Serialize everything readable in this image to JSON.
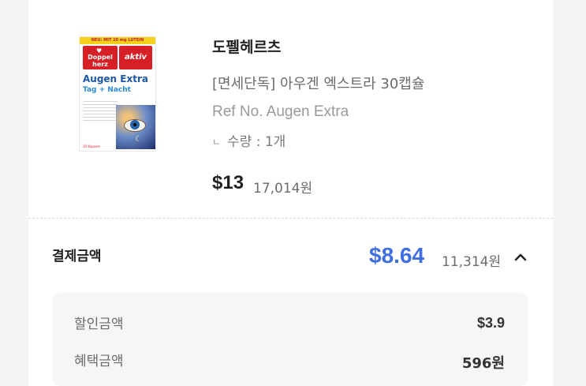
{
  "product": {
    "brand": "도펠헤르츠",
    "name": "[면세단독] 아우겐 엑스트라 30캡슐",
    "ref": "Ref No. Augen Extra",
    "quantity_marker": "ㄴ",
    "quantity": "수량 : 1개",
    "price_usd": "$13",
    "price_krw": "17,014원",
    "image": {
      "top_band": "NEU: MIT 20 mg LUTEIN",
      "logo": "Doppel herz",
      "badge": "aktiv",
      "title": "Augen Extra",
      "subtitle": "Tag + Nacht",
      "footer": "30 Kapseln"
    }
  },
  "payment": {
    "label": "결제금액",
    "total_usd": "$8.64",
    "total_krw": "11,314원",
    "toggle_icon": "chevron-up-icon"
  },
  "details": [
    {
      "label": "할인금액",
      "value": "$3.9"
    },
    {
      "label": "혜택금액",
      "value": "596원"
    }
  ],
  "colors": {
    "accent": "#3e6ee0",
    "page_bg": "#f4f5f7",
    "detail_bg": "#f5f6f8"
  }
}
